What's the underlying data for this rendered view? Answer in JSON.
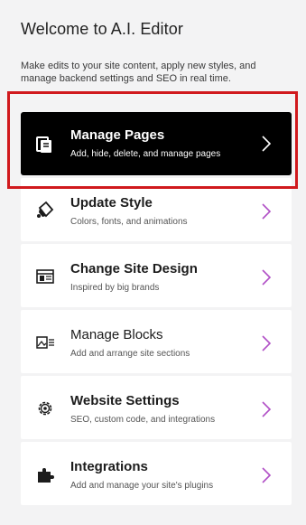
{
  "header": {
    "title": "Welcome to A.I. Editor",
    "intro": "Make edits to your site content, apply new styles, and manage backend settings and SEO in real time."
  },
  "menu": [
    {
      "label": "Manage Pages",
      "description": "Add, hide, delete, and manage pages",
      "icon": "pages-icon",
      "active": true
    },
    {
      "label": "Update Style",
      "description": "Colors, fonts, and animations",
      "icon": "paint-bucket-icon",
      "active": false
    },
    {
      "label": "Change Site Design",
      "description": "Inspired by big brands",
      "icon": "layout-icon",
      "active": false
    },
    {
      "label": "Manage Blocks",
      "description": "Add and arrange site sections",
      "icon": "blocks-icon",
      "active": false
    },
    {
      "label": "Website Settings",
      "description": "SEO, custom code, and integrations",
      "icon": "gear-icon",
      "active": false
    },
    {
      "label": "Integrations",
      "description": "Add and manage your site's plugins",
      "icon": "puzzle-icon",
      "active": false
    }
  ],
  "colors": {
    "accent_chevron": "#b04fc6",
    "active_background": "#000000",
    "highlight_border": "#d0191d"
  }
}
